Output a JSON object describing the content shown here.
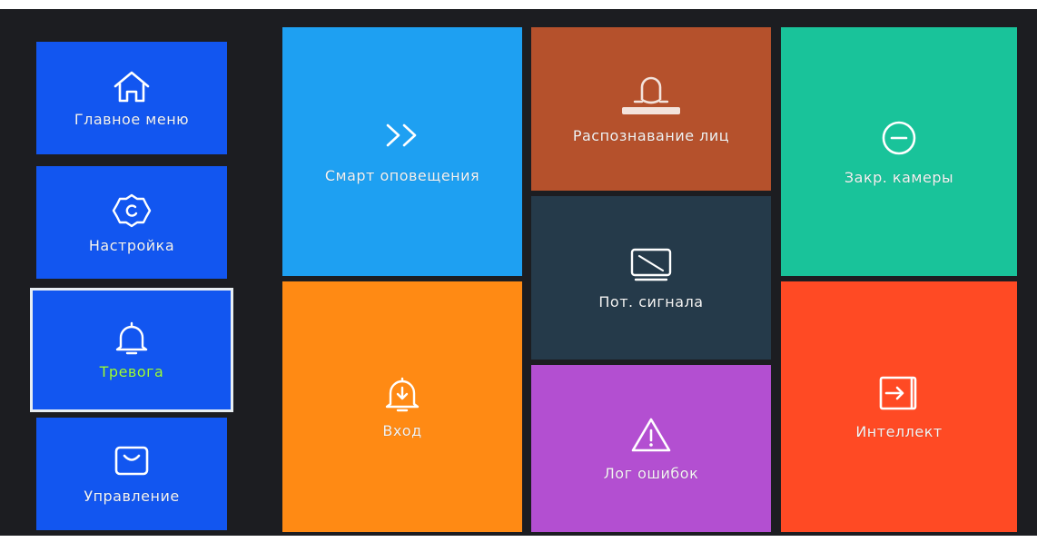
{
  "sidebar": {
    "items": [
      {
        "label": "Главное меню",
        "icon": "home-icon",
        "active": false
      },
      {
        "label": "Настройка",
        "icon": "gear-icon",
        "active": false
      },
      {
        "label": "Тревога",
        "icon": "bell-icon",
        "active": true
      },
      {
        "label": "Управление",
        "icon": "shopping-bag-icon",
        "active": false
      }
    ]
  },
  "tiles": {
    "smart_alert": {
      "label": "Смарт оповещения",
      "icon": "double-chevron-right-icon",
      "color": "#1ea0f2"
    },
    "face_recognition": {
      "label": "Распознавание лиц",
      "icon": "face-icon",
      "color": "#b5512c"
    },
    "camera_masking": {
      "label": "Закр. камеры",
      "icon": "minus-circle-icon",
      "color": "#19c39a"
    },
    "signal_loss": {
      "label": "Пот. сигнала",
      "icon": "no-signal-monitor-icon",
      "color": "#253a4a"
    },
    "input": {
      "label": "Вход",
      "icon": "bell-download-icon",
      "color": "#ff8a14"
    },
    "error_log": {
      "label": "Лог ошибок",
      "icon": "warning-triangle-icon",
      "color": "#b34fd1"
    },
    "intelligence": {
      "label": "Интеллект",
      "icon": "login-box-icon",
      "color": "#ff4a24"
    }
  },
  "colors": {
    "sidebar_blue": "#1256f0",
    "active_label": "#9dff3a",
    "background": "#1c1d21"
  }
}
